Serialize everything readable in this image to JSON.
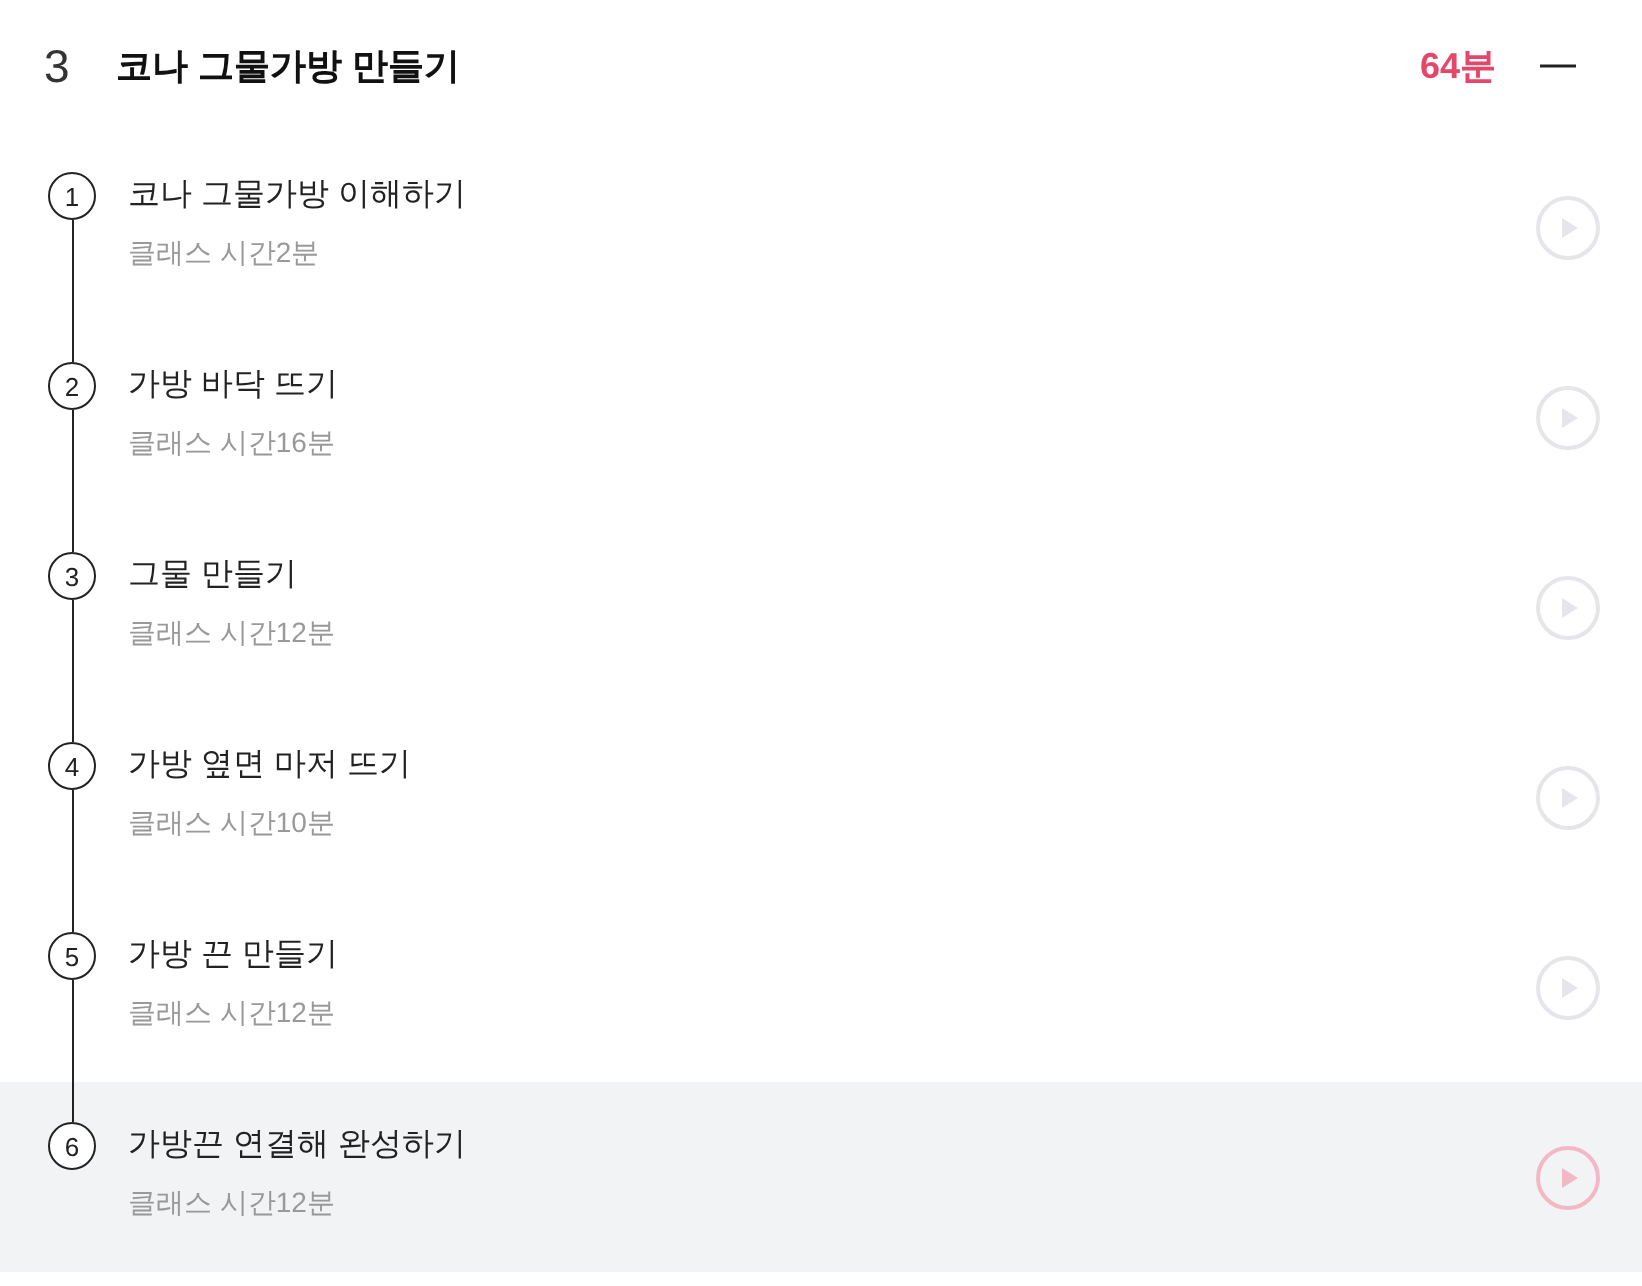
{
  "section": {
    "number": "3",
    "title": "코나 그물가방 만들기",
    "duration": "64분",
    "expanded": true
  },
  "lessons": [
    {
      "number": "1",
      "title": "코나 그물가방 이해하기",
      "duration": "클래스 시간2분",
      "selected": false
    },
    {
      "number": "2",
      "title": "가방 바닥 뜨기",
      "duration": "클래스 시간16분",
      "selected": false
    },
    {
      "number": "3",
      "title": "그물 만들기",
      "duration": "클래스 시간12분",
      "selected": false
    },
    {
      "number": "4",
      "title": "가방 옆면 마저 뜨기",
      "duration": "클래스 시간10분",
      "selected": false
    },
    {
      "number": "5",
      "title": "가방 끈 만들기",
      "duration": "클래스 시간12분",
      "selected": false
    },
    {
      "number": "6",
      "title": "가방끈 연결해 완성하기",
      "duration": "클래스 시간12분",
      "selected": true
    }
  ]
}
